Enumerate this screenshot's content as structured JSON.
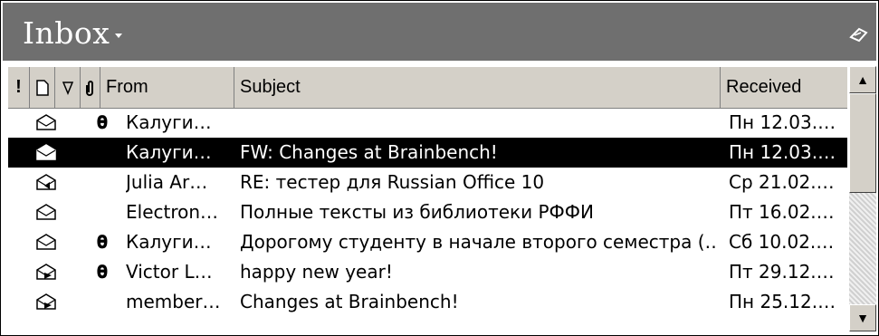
{
  "window": {
    "title": "Inbox"
  },
  "columns": {
    "importance_icon": "!",
    "icon_col": "document-icon",
    "flag_col": "flag-icon",
    "attach_col": "paperclip-icon",
    "from": "From",
    "subject": "Subject",
    "received": "Received"
  },
  "messages": [
    {
      "icon": "envelope-open-icon",
      "attachment": true,
      "from": "Калуги…",
      "subject": "",
      "received": "Пн 12.03.…",
      "selected": false
    },
    {
      "icon": "envelope-open-icon",
      "attachment": false,
      "from": "Калуги…",
      "subject": "FW: Changes at Brainbench!",
      "received": "Пн 12.03.…",
      "selected": true
    },
    {
      "icon": "envelope-replied-icon",
      "attachment": false,
      "from": "Julia Ar…",
      "subject": "RE: тестер для Russian Office 10",
      "received": "Ср 21.02.…",
      "selected": false
    },
    {
      "icon": "envelope-open-icon",
      "attachment": false,
      "from": "Electron…",
      "subject": "Полные тексты из библиотеки РФФИ",
      "received": "Пт 16.02.…",
      "selected": false
    },
    {
      "icon": "envelope-open-icon",
      "attachment": true,
      "from": "Калуги…",
      "subject": "Дорогому студенту в начале второго семестра (…",
      "received": "Сб 10.02.…",
      "selected": false
    },
    {
      "icon": "envelope-forwarded-icon",
      "attachment": true,
      "from": "Victor L…",
      "subject": "happy new year!",
      "received": "Пт 29.12.…",
      "selected": false
    },
    {
      "icon": "envelope-forwarded-icon",
      "attachment": false,
      "from": "member…",
      "subject": "Changes at Brainbench!",
      "received": "Пн 25.12.…",
      "selected": false
    }
  ],
  "colors": {
    "titlebar": "#6f6f6f",
    "selection": "#000000",
    "header": "#d4d0c8"
  }
}
